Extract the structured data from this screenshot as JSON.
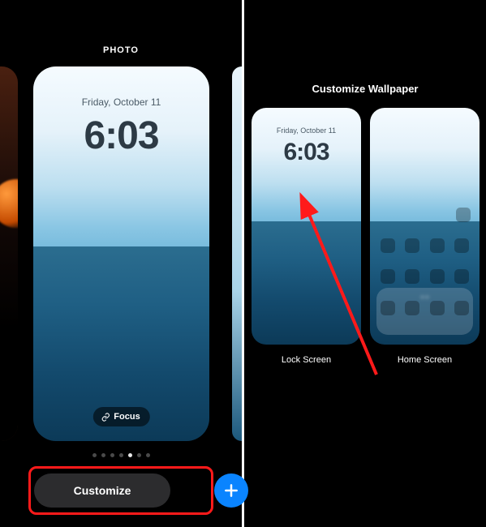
{
  "left": {
    "header_label": "PHOTO",
    "lock_date": "Friday, October 11",
    "lock_time": "6:03",
    "focus_label": "Focus",
    "page_dots": {
      "count": 7,
      "active_index": 4
    },
    "customize_label": "Customize"
  },
  "right": {
    "title": "Customize Wallpaper",
    "lock_date": "Friday, October 11",
    "lock_time": "6:03",
    "lock_label": "Lock Screen",
    "home_label": "Home Screen"
  }
}
